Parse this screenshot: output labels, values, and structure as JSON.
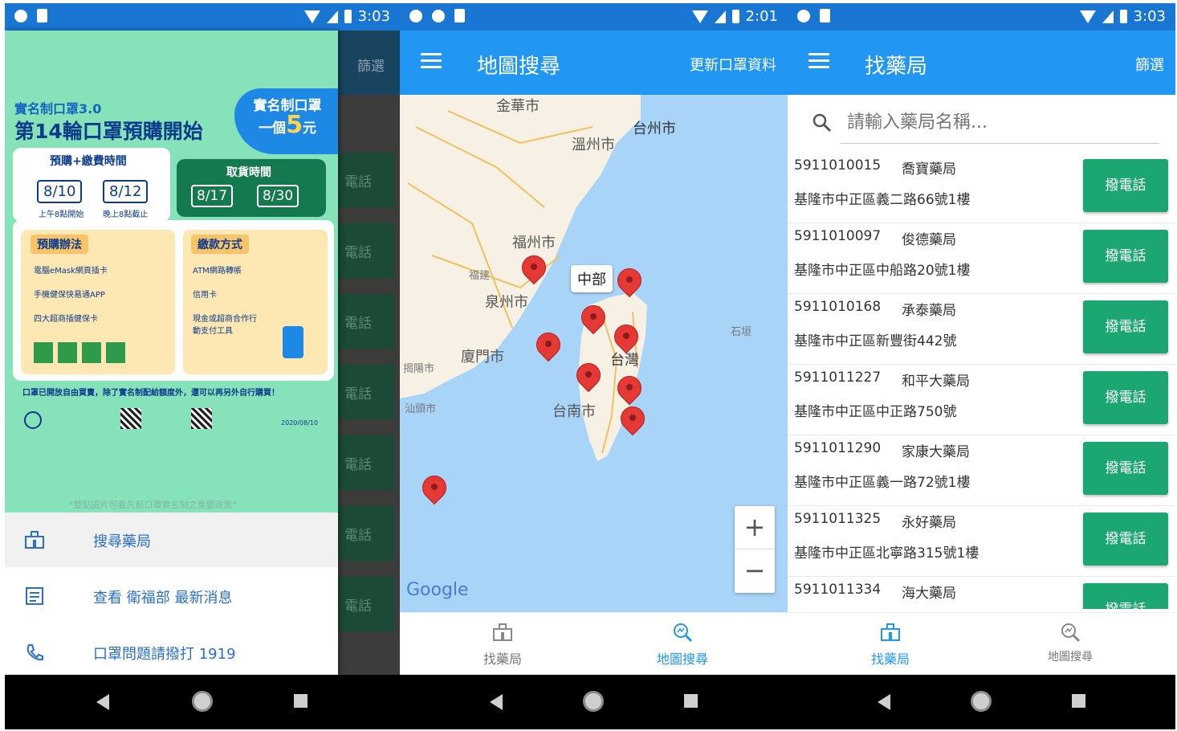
{
  "colors": {
    "primary": "#2196f3",
    "status_bar": "#1976d2",
    "call_button": "#1ca672",
    "pin": "#e53935",
    "accent_blue": "#2a6fc9"
  },
  "screen1": {
    "status_time": "3:03",
    "behind_title": "篩選",
    "behind_button_label": "電話",
    "poster": {
      "subtitle": "實名制口罩3.0",
      "title": "第14輪口罩預購開始",
      "tag_line1": "實名制口罩",
      "tag_line2_pre": "一個",
      "tag_big": "5",
      "tag_line2_post": "元",
      "preorder_heading": "預購+繳費時間",
      "preorder_from": "8/10",
      "preorder_to": "8/12",
      "preorder_from_note": "上午8點開始",
      "preorder_to_note": "晚上8點截止",
      "pickup_heading": "取貨時間",
      "pickup_from": "8/17",
      "pickup_to": "8/30",
      "method_heading": "預購辦法",
      "method_items": [
        "電腦eMask網頁插卡",
        "手機健保快易通APP",
        "四大超商插健保卡"
      ],
      "pay_heading": "繳款方式",
      "pay_items": [
        "ATM網路轉帳",
        "信用卡",
        "現金或超商合作行動支付工具"
      ],
      "footer": "口罩已開放自由買賣，除了實名制配給額度外，還可以再另外自行購買！",
      "date_stamp": "2020/08/10",
      "hint": "*雙點圖片可看先前口罩實名制之重要政策*"
    },
    "menu": [
      {
        "label": "搜尋藥局",
        "icon": "pharmacy-icon"
      },
      {
        "label": "查看 衛福部 最新消息",
        "icon": "news-icon"
      },
      {
        "label": "口罩問題請撥打 1919",
        "icon": "phone-icon"
      }
    ]
  },
  "screen2": {
    "status_time": "2:01",
    "title": "地圖搜尋",
    "action": "更新口罩資料",
    "map_labels": {
      "taizhou": "台州市",
      "wenzhou": "溫州市",
      "fuzhou": "福州市",
      "fujian": "福建",
      "quanzhou": "泉州市",
      "xiamen": "廈門市",
      "shantou": "汕頭市",
      "jieyang": "揭陽市",
      "taiwan": "台灣",
      "tainan": "台南市",
      "shigaki": "石垣",
      "jinhua": "金華市"
    },
    "callout": "中部",
    "zoom_in": "+",
    "zoom_out": "−",
    "google": "Google",
    "nav": [
      {
        "label": "找藥局",
        "icon": "pharmacy-icon"
      },
      {
        "label": "地圖搜尋",
        "icon": "map-search-icon"
      }
    ]
  },
  "screen3": {
    "status_time": "3:03",
    "title": "找藥局",
    "action": "篩選",
    "search_placeholder": "請輸入藥局名稱...",
    "call_label": "撥電話",
    "rows": [
      {
        "code": "5911010015",
        "name": "喬寶藥局",
        "address": "基隆市中正區義二路66號1樓"
      },
      {
        "code": "5911010097",
        "name": "俊德藥局",
        "address": "基隆市中正區中船路20號1樓"
      },
      {
        "code": "5911010168",
        "name": "承泰藥局",
        "address": "基隆市中正區新豐街442號"
      },
      {
        "code": "5911011227",
        "name": "和平大藥局",
        "address": "基隆市中正區中正路750號"
      },
      {
        "code": "5911011290",
        "name": "家康大藥局",
        "address": "基隆市中正區義一路72號1樓"
      },
      {
        "code": "5911011325",
        "name": "永好藥局",
        "address": "基隆市中正區北寧路315號1樓"
      },
      {
        "code": "5911011334",
        "name": "海大藥局",
        "address": ""
      }
    ],
    "nav": [
      {
        "label": "找藥局",
        "icon": "pharmacy-icon"
      },
      {
        "label": "地圖搜尋",
        "icon": "map-search-icon"
      }
    ]
  }
}
